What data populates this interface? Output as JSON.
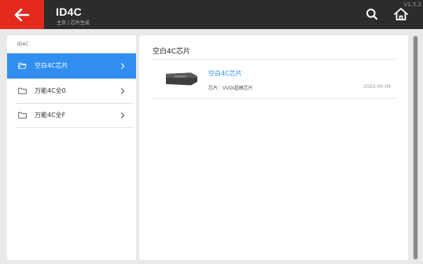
{
  "header": {
    "title": "ID4C",
    "breadcrumb": "主页 / 芯片生成",
    "version": "V1.5.2",
    "accent_color": "#e32a1c",
    "icons": [
      "back-arrow-icon",
      "search-icon",
      "home-icon"
    ]
  },
  "sidebar": {
    "heading": "ID4C",
    "active_color": "#2f8ef0",
    "items": [
      {
        "label": "空白4C芯片",
        "icon": "folder-open-icon",
        "active": true
      },
      {
        "label": "万能4C全0",
        "icon": "folder-icon",
        "active": false
      },
      {
        "label": "万能4C全F",
        "icon": "folder-icon",
        "active": false
      }
    ]
  },
  "content": {
    "title": "空白4C芯片",
    "items": [
      {
        "title": "空白4C芯片",
        "subtitle": "芯片：VVDI超模芯片",
        "date": "2020-06-04",
        "image": "chip-icon"
      }
    ]
  }
}
